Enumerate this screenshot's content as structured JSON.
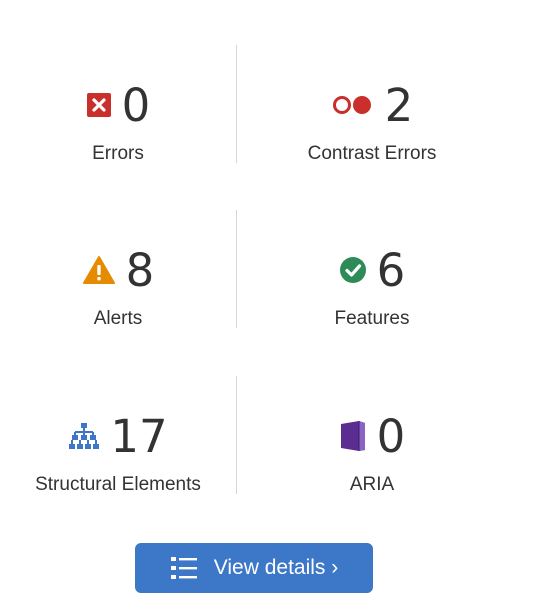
{
  "summary": {
    "errors": {
      "count": "0",
      "label": "Errors",
      "icon": "error-x-icon",
      "color": "#c9302c"
    },
    "contrast_errors": {
      "count": "2",
      "label": "Contrast Errors",
      "icon": "contrast-icon",
      "color": "#c9302c"
    },
    "alerts": {
      "count": "8",
      "label": "Alerts",
      "icon": "alert-triangle-icon",
      "color": "#e68a00"
    },
    "features": {
      "count": "6",
      "label": "Features",
      "icon": "check-circle-icon",
      "color": "#2e8b57"
    },
    "structural_elements": {
      "count": "17",
      "label": "Structural Elements",
      "icon": "sitemap-icon",
      "color": "#3d78c8"
    },
    "aria": {
      "count": "0",
      "label": "ARIA",
      "icon": "aria-book-icon",
      "color": "#5b2d91"
    }
  },
  "details_button": {
    "label": "View details ›",
    "icon": "list-icon",
    "color": "#3d78c8"
  }
}
